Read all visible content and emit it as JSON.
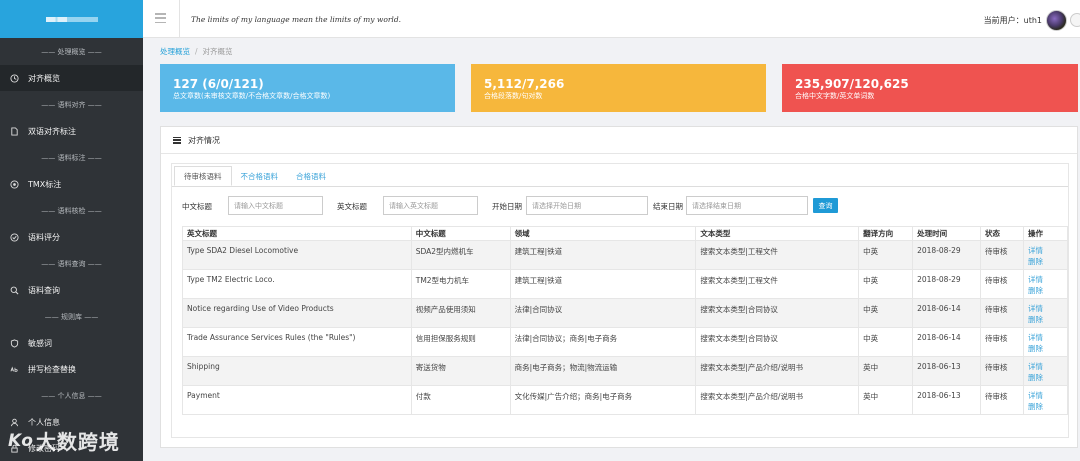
{
  "sidebar": {
    "groups": [
      {
        "title": "—— 处理概览 ——",
        "items": [
          {
            "label": "对齐概览",
            "icon": "clock-icon",
            "active": true
          }
        ]
      },
      {
        "title": "—— 语料对齐 ——",
        "items": [
          {
            "label": "双语对齐标注",
            "icon": "document-icon"
          }
        ]
      },
      {
        "title": "—— 语料标注 ——",
        "items": [
          {
            "label": "TMX标注",
            "icon": "plus-circle-icon"
          }
        ]
      },
      {
        "title": "—— 语料核检 ——",
        "items": [
          {
            "label": "语料评分",
            "icon": "check-circle-icon"
          }
        ]
      },
      {
        "title": "—— 语料查询 ——",
        "items": [
          {
            "label": "语料查询",
            "icon": "search-icon"
          }
        ]
      },
      {
        "title": "—— 规则库 ——",
        "items": [
          {
            "label": "敏感词",
            "icon": "shield-icon"
          },
          {
            "label": "拼写检查替换",
            "icon": "spellcheck-icon"
          }
        ]
      },
      {
        "title": "—— 个人信息 ——",
        "items": [
          {
            "label": "个人信息",
            "icon": "user-icon"
          },
          {
            "label": "修改密码",
            "icon": "lock-icon"
          }
        ]
      }
    ],
    "watermark": "大数跨境",
    "watermark_mark": "Ko"
  },
  "header": {
    "motto": "The limits of my language mean the limits of my world.",
    "user_label": "当前用户：uth1"
  },
  "breadcrumb": {
    "root": "处理概览",
    "sep": "/",
    "current": "对齐概览"
  },
  "stats": [
    {
      "value": "127 (6/0/121)",
      "desc": "总文章数(未审核文章数/不合格文章数/合格文章数)",
      "color": "#5ab8e8"
    },
    {
      "value": "5,112/7,266",
      "desc": "合格段落数/句对数",
      "color": "#f6b73c"
    },
    {
      "value": "235,907/120,625",
      "desc": "合格中文字数/英文单词数",
      "color": "#ef5350"
    }
  ],
  "panel": {
    "title": "对齐情况",
    "tabs": [
      "待审核语料",
      "不合格语料",
      "合格语料"
    ],
    "filters": {
      "cn_title_label": "中文标题",
      "cn_title_placeholder": "请输入中文标题",
      "en_title_label": "英文标题",
      "en_title_placeholder": "请输入英文标题",
      "start_label": "开始日期",
      "start_placeholder": "请选择开始日期",
      "end_label": "结束日期",
      "end_placeholder": "请选择结束日期",
      "query_label": "查询"
    },
    "columns": [
      "英文标题",
      "中文标题",
      "领域",
      "文本类型",
      "翻译方向",
      "处理时间",
      "状态",
      "操作"
    ],
    "rows": [
      [
        "Type SDA2 Diesel Locomotive",
        "SDA2型内燃机车",
        "建筑工程|铁道",
        "搜索文本类型|工程文件",
        "中英",
        "2018-08-29",
        "待审核"
      ],
      [
        "Type TM2 Electric Loco.",
        "TM2型电力机车",
        "建筑工程|铁道",
        "搜索文本类型|工程文件",
        "中英",
        "2018-08-29",
        "待审核"
      ],
      [
        "Notice regarding Use of Video Products",
        "视频产品使用须知",
        "法律|合同协议",
        "搜索文本类型|合同协议",
        "中英",
        "2018-06-14",
        "待审核"
      ],
      [
        "Trade Assurance Services Rules (the \"Rules\")",
        "信用担保服务规则",
        "法律|合同协议；商务|电子商务",
        "搜索文本类型|合同协议",
        "中英",
        "2018-06-14",
        "待审核"
      ],
      [
        "Shipping",
        "寄送货物",
        "商务|电子商务；物流|物流运输",
        "搜索文本类型|产品介绍/说明书",
        "英中",
        "2018-06-13",
        "待审核"
      ],
      [
        "Payment",
        "付款",
        "文化传媒|广告介绍；商务|电子商务",
        "搜索文本类型|产品介绍/说明书",
        "英中",
        "2018-06-13",
        "待审核"
      ]
    ],
    "op_detail": "详情",
    "op_delete": "删除"
  }
}
